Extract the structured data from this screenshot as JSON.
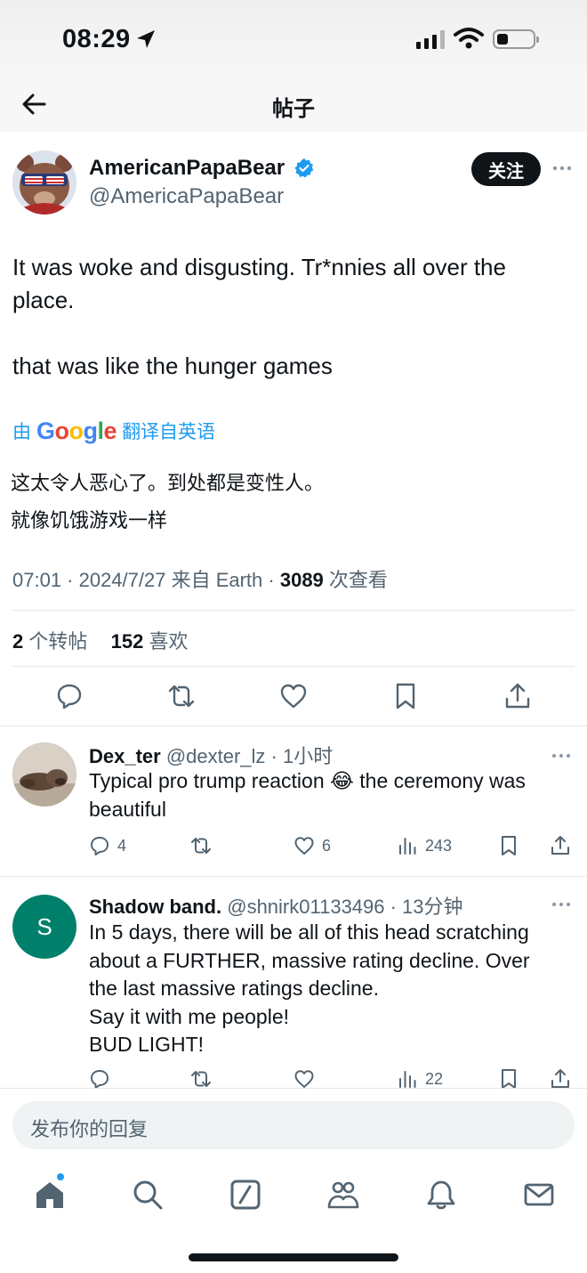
{
  "status": {
    "time": "08:29"
  },
  "nav": {
    "title": "帖子"
  },
  "author": {
    "name": "AmericanPapaBear",
    "handle": "@AmericaPapaBear",
    "follow_label": "关注"
  },
  "tweet": {
    "text_line1": "It was woke and disgusting. Tr*nnies all over the place.",
    "text_line2": "that was like the hunger games",
    "translate_prefix": "由",
    "translate_suffix": "翻译自英语",
    "translation_line1": "这太令人恶心了。到处都是变性人。",
    "translation_line2": "就像饥饿游戏一样",
    "meta_prefix": "07:01 · 2024/7/27 来自 Earth · ",
    "views": "3089",
    "views_label": " 次查看",
    "reposts": "2",
    "reposts_label": " 个转帖",
    "likes": "152",
    "likes_label": " 喜欢"
  },
  "replies": [
    {
      "name": "Dex_ter",
      "meta": " @dexter_lz · 1小时",
      "text_before_emoji": "Typical pro trump reaction ",
      "emoji": "😂",
      "text_after_emoji": " the ceremony was beautiful",
      "reply_count": "4",
      "like_count": "6",
      "view_count": "243"
    },
    {
      "name": "Shadow band.",
      "avatar_letter": "S",
      "meta": " @shnirk01133496 · 13分钟",
      "lines": [
        "In 5 days, there will be all of this head scratching",
        "about a FURTHER, massive rating decline. Over",
        "the last massive ratings decline.",
        "Say it with me people!",
        "BUD LIGHT!"
      ],
      "view_count": "22"
    }
  ],
  "reply_box": {
    "placeholder": "发布你的回复"
  },
  "colors": {
    "accent": "#1d9bf0",
    "text": "#0f1419",
    "muted": "#536471",
    "avatar_green": "#00806b"
  },
  "icons": [
    "back-arrow-icon",
    "verified-badge-icon",
    "more-icon",
    "reply-icon",
    "retweet-icon",
    "like-icon",
    "bookmark-icon",
    "share-icon",
    "views-icon",
    "home-icon",
    "search-icon",
    "compose-icon",
    "communities-icon",
    "notifications-icon",
    "messages-icon"
  ]
}
